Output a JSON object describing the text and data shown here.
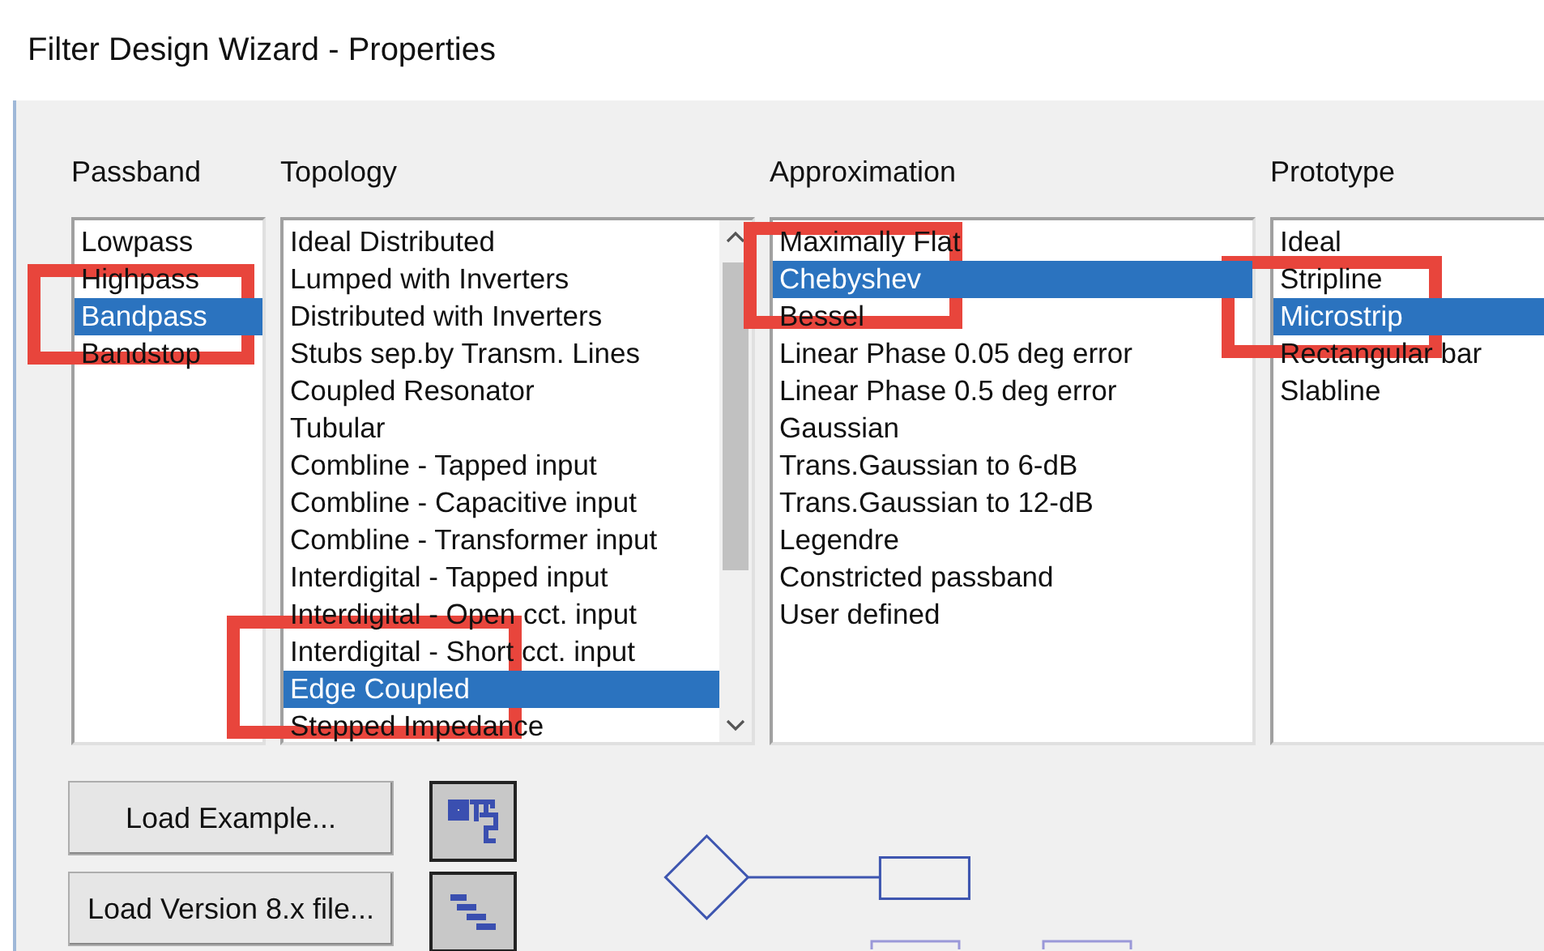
{
  "window": {
    "title": "Filter Design Wizard - Properties"
  },
  "lists": [
    {
      "label": "Passband",
      "items": [
        {
          "text": "Lowpass",
          "selected": false
        },
        {
          "text": "Highpass",
          "selected": false
        },
        {
          "text": "Bandpass",
          "selected": true
        },
        {
          "text": "Bandstop",
          "selected": false
        }
      ]
    },
    {
      "label": "Topology",
      "scrollbar": true,
      "items": [
        {
          "text": "Ideal Distributed",
          "selected": false
        },
        {
          "text": "Lumped with Inverters",
          "selected": false
        },
        {
          "text": "Distributed with Inverters",
          "selected": false
        },
        {
          "text": "Stubs sep.by Transm. Lines",
          "selected": false
        },
        {
          "text": "Coupled Resonator",
          "selected": false
        },
        {
          "text": "Tubular",
          "selected": false
        },
        {
          "text": "Combline - Tapped input",
          "selected": false
        },
        {
          "text": "Combline - Capacitive input",
          "selected": false
        },
        {
          "text": "Combline - Transformer input",
          "selected": false
        },
        {
          "text": "Interdigital - Tapped input",
          "selected": false
        },
        {
          "text": "Interdigital - Open cct. input",
          "selected": false
        },
        {
          "text": "Interdigital - Short cct. input",
          "selected": false
        },
        {
          "text": "Edge Coupled",
          "selected": true
        },
        {
          "text": "Stepped Impedance",
          "selected": false
        }
      ]
    },
    {
      "label": "Approximation",
      "items": [
        {
          "text": "Maximally Flat",
          "selected": false
        },
        {
          "text": "Chebyshev",
          "selected": true
        },
        {
          "text": "Bessel",
          "selected": false
        },
        {
          "text": "Linear Phase 0.05 deg error",
          "selected": false
        },
        {
          "text": "Linear Phase 0.5 deg error",
          "selected": false
        },
        {
          "text": "Gaussian",
          "selected": false
        },
        {
          "text": "Trans.Gaussian to 6-dB",
          "selected": false
        },
        {
          "text": "Trans.Gaussian to 12-dB",
          "selected": false
        },
        {
          "text": "Legendre",
          "selected": false
        },
        {
          "text": "Constricted passband",
          "selected": false
        },
        {
          "text": "User defined",
          "selected": false
        }
      ]
    },
    {
      "label": "Prototype",
      "items": [
        {
          "text": "Ideal",
          "selected": false
        },
        {
          "text": "Stripline",
          "selected": false
        },
        {
          "text": "Microstrip",
          "selected": true
        },
        {
          "text": "Rectangular bar",
          "selected": false
        },
        {
          "text": "Slabline",
          "selected": false
        }
      ]
    }
  ],
  "buttons": [
    {
      "label": "Load Example..."
    },
    {
      "label": "Load Version 8.x file..."
    }
  ]
}
